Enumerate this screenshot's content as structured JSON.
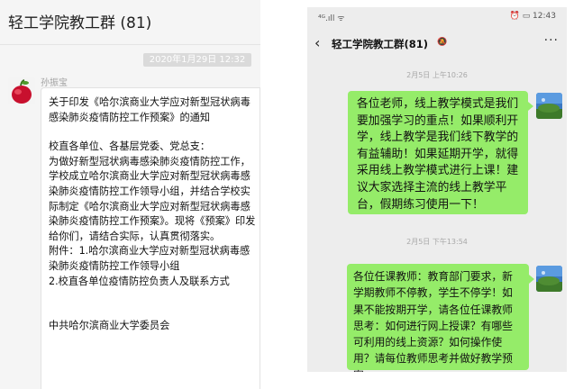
{
  "left": {
    "title": "轻工学院教工群 (81)",
    "timestamp": "2020年1月29日 12:32",
    "sender": "孙振宝",
    "message": {
      "heading": "关于印发《哈尔滨商业大学应对新型冠状病毒感染肺炎疫情防控工作预案》的通知",
      "salutation": "校直各单位、各基层党委、党总支：",
      "body": "为做好新型冠状病毒感染肺炎疫情防控工作，学校成立哈尔滨商业大学应对新型冠状病毒感染肺炎疫情防控工作领导小组，并结合学校实际制定《哈尔滨商业大学应对新型冠状病毒感染肺炎疫情防控工作预案》。现将《预案》印发给你们，请结合实际，认真贯彻落实。",
      "attachment1": "附件：1.哈尔滨商业大学应对新型冠状病毒感染肺炎疫情防控工作领导小组",
      "attachment2": "2.校直各单位疫情防控负责人及联系方式",
      "signature": "中共哈尔滨商业大学委员会"
    }
  },
  "right": {
    "status_signal": "⁴ᴳ.ıll ᯤ",
    "status_system": "⏰ ▭ 12:43",
    "title": "轻工学院教工群(81)",
    "mute_icon": "🔕",
    "back_icon": "‹",
    "more_icon": "···",
    "messages": [
      {
        "time": "2月5日 上午10:26",
        "text": "各位老师，线上教学模式是我们要加强学习的重点！如果顺利开学，线上教学是我们线下教学的有益辅助！如果延期开学，就得采用线上教学模式进行上课！建议大家选择主流的线上教学平台，假期练习使用一下！"
      },
      {
        "time": "2月5日 下午13:54",
        "text": "各位任课教师：教育部门要求，新学期教师不停教，学生不停学！如果不能按期开学，请各位任课教师思考：如何进行网上授课？有哪些可利用的线上资源？如何操作使用？请每位教师思考并做好教学预案。"
      }
    ]
  }
}
